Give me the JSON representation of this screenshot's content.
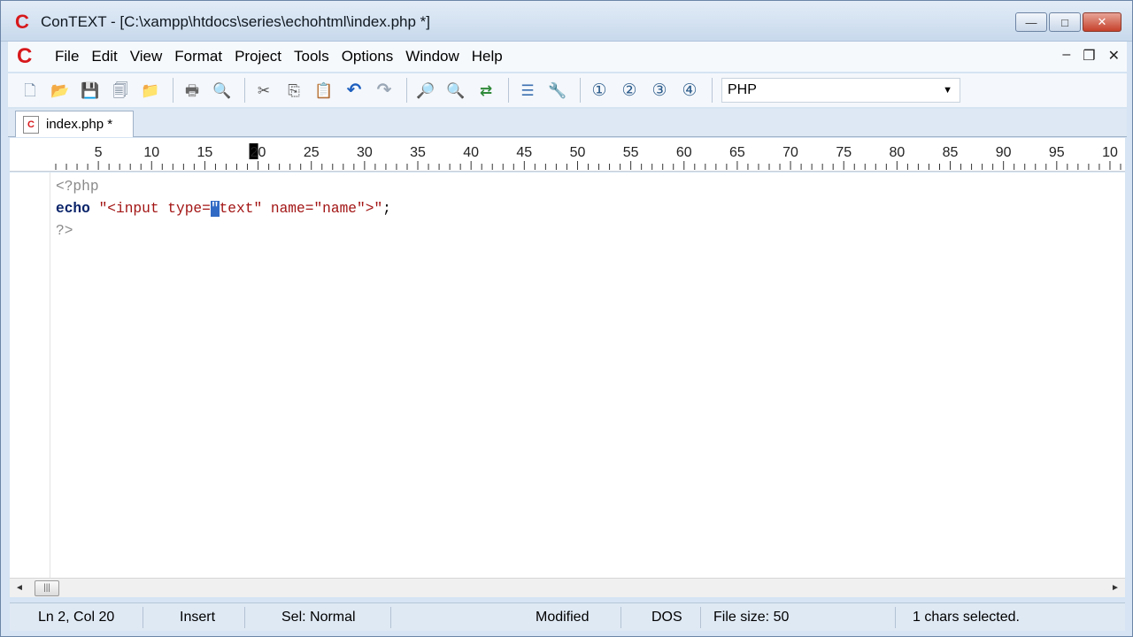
{
  "window": {
    "title": "ConTEXT - [C:\\xampp\\htdocs\\series\\echohtml\\index.php *]",
    "app_logo": "C",
    "buttons": {
      "minimize": "—",
      "maximize": "□",
      "close": "✕"
    }
  },
  "menubar": {
    "logo": "C",
    "items": [
      "File",
      "Edit",
      "View",
      "Format",
      "Project",
      "Tools",
      "Options",
      "Window",
      "Help"
    ],
    "mdi_controls": {
      "minimize": "–",
      "restore": "❐",
      "close": "✕"
    }
  },
  "toolbar": {
    "buttons": [
      {
        "name": "new-file-icon",
        "glyph": "🗋"
      },
      {
        "name": "open-folder-icon",
        "glyph": "📂"
      },
      {
        "name": "save-icon",
        "glyph": "💾"
      },
      {
        "name": "save-all-icon",
        "glyph": "🗐"
      },
      {
        "name": "open-project-icon",
        "glyph": "📁"
      },
      {
        "name": "print-icon",
        "glyph": "🖶"
      },
      {
        "name": "print-preview-icon",
        "glyph": "🔍"
      },
      {
        "name": "cut-icon",
        "glyph": "✂"
      },
      {
        "name": "copy-icon",
        "glyph": "⎘"
      },
      {
        "name": "paste-icon",
        "glyph": "📋"
      },
      {
        "name": "undo-icon",
        "glyph": "↶"
      },
      {
        "name": "redo-icon",
        "glyph": "↷"
      },
      {
        "name": "find-icon",
        "glyph": "🔎"
      },
      {
        "name": "find-next-icon",
        "glyph": "🔍"
      },
      {
        "name": "replace-icon",
        "glyph": "⇄"
      },
      {
        "name": "file-list-icon",
        "glyph": "☰"
      },
      {
        "name": "tools-icon",
        "glyph": "🔧"
      },
      {
        "name": "user-exec-1-icon",
        "glyph": "①"
      },
      {
        "name": "user-exec-2-icon",
        "glyph": "②"
      },
      {
        "name": "user-exec-3-icon",
        "glyph": "③"
      },
      {
        "name": "user-exec-4-icon",
        "glyph": "④"
      }
    ],
    "highlighter": "PHP"
  },
  "tabs": [
    {
      "label": "index.php *",
      "icon": "C"
    }
  ],
  "ruler": {
    "labels": [
      "5",
      "10",
      "15",
      "20",
      "25",
      "30",
      "35",
      "40",
      "45",
      "50",
      "55",
      "60",
      "65",
      "70",
      "75",
      "80",
      "85",
      "90",
      "95",
      "10"
    ],
    "current_column": "20"
  },
  "editor": {
    "lines": [
      [
        {
          "t": "<?php",
          "c": "tag"
        }
      ],
      [
        {
          "t": "echo",
          "c": "kw"
        },
        {
          "t": " ",
          "c": ""
        },
        {
          "t": "\"<input type=",
          "c": "str"
        },
        {
          "t": "\"",
          "c": "sel"
        },
        {
          "t": "text\" name=\"name\">\"",
          "c": "str"
        },
        {
          "t": ";",
          "c": ""
        }
      ],
      [
        {
          "t": "?>",
          "c": "tag"
        }
      ]
    ]
  },
  "scrollbar": {
    "left": "◄",
    "thumb": "|||",
    "right": "►"
  },
  "statusbar": {
    "position": "Ln 2, Col 20",
    "mode": "Insert",
    "selection_mode": "Sel: Normal",
    "modified": "Modified",
    "line_endings": "DOS",
    "file_size": "File size: 50",
    "selected": "1 chars selected."
  }
}
